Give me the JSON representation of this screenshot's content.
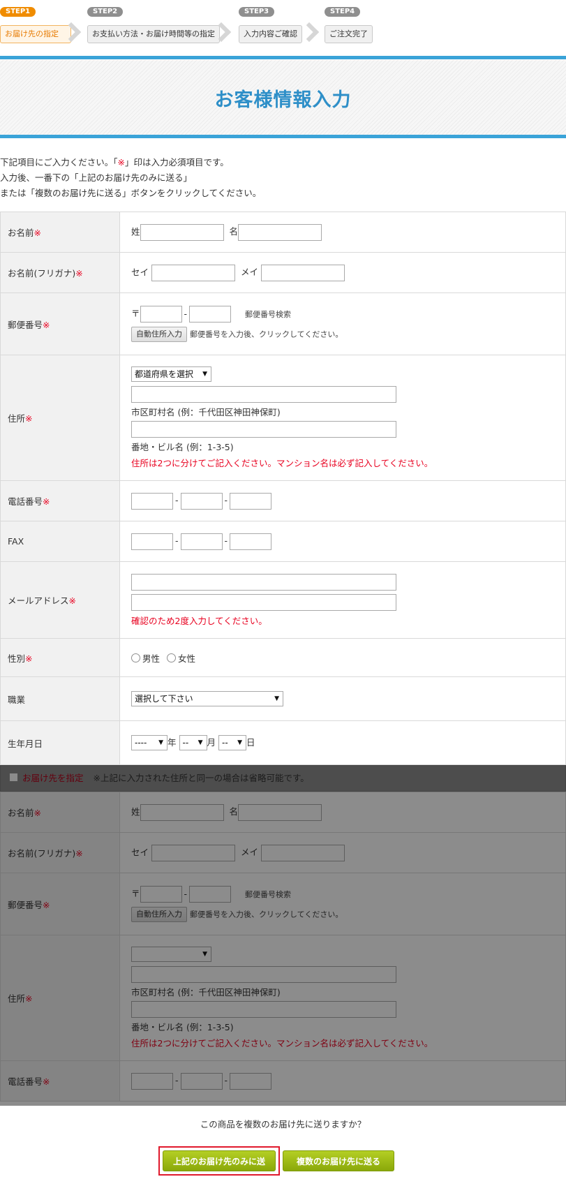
{
  "steps": [
    {
      "tag": "STEP1",
      "label": "お届け先の指定"
    },
    {
      "tag": "STEP2",
      "label": "お支払い方法・お届け時間等の指定"
    },
    {
      "tag": "STEP3",
      "label": "入力内容ご確認"
    },
    {
      "tag": "STEP4",
      "label": "ご注文完了"
    }
  ],
  "page_title": "お客様情報入力",
  "intro": [
    "下記項目にご入力ください。「",
    "※",
    "」印は入力必須項目です。",
    "入力後、一番下の「上記のお届け先のみに送る」",
    "または「複数のお届け先に送る」ボタンをクリックしてください。"
  ],
  "required_mark": "※",
  "customer": {
    "name_label": "お名前",
    "sei_kanji": "姓",
    "mei_kanji": "名",
    "kana_label": "お名前(フリガナ)",
    "sei_kana": "セイ",
    "mei_kana": "メイ",
    "zip_label": "郵便番号",
    "zip_mark": "〒",
    "zip_dash": "-",
    "zip_search": "郵便番号検索",
    "auto_address_button": "自動住所入力",
    "auto_address_hint": "郵便番号を入力後、クリックしてください。",
    "address_label": "住所",
    "pref_select": "都道府県を選択",
    "city_hint": "市区町村名 (例：千代田区神田神保町)",
    "street_hint": "番地・ビル名 (例：1-3-5)",
    "address_note": "住所は2つに分けてご記入ください。マンション名は必ず記入してください。",
    "tel_label": "電話番号",
    "fax_label": "FAX",
    "email_label": "メールアドレス",
    "email_note": "確認のため2度入力してください。",
    "gender_label": "性別",
    "male": "男性",
    "female": "女性",
    "job_label": "職業",
    "job_select": "選択して下さい",
    "birth_label": "生年月日",
    "year_select": "----",
    "year_unit": "年",
    "month_select": "--",
    "month_unit": "月",
    "day_select": "--",
    "day_unit": "日"
  },
  "shipping": {
    "checkbox_label": "お届け先を指定",
    "omit_note": "※上記に入力された住所と同一の場合は省略可能です。"
  },
  "bottom": {
    "question": "この商品を複数のお届け先に送りますか？",
    "single_button": "上記のお届け先のみに送る",
    "multi_button": "複数のお届け先に送る"
  },
  "colors": {
    "accent_blue": "#2e8fc8",
    "step_active": "#f08c00",
    "required_red": "#e8001f",
    "button_green": "#9bbb14"
  }
}
